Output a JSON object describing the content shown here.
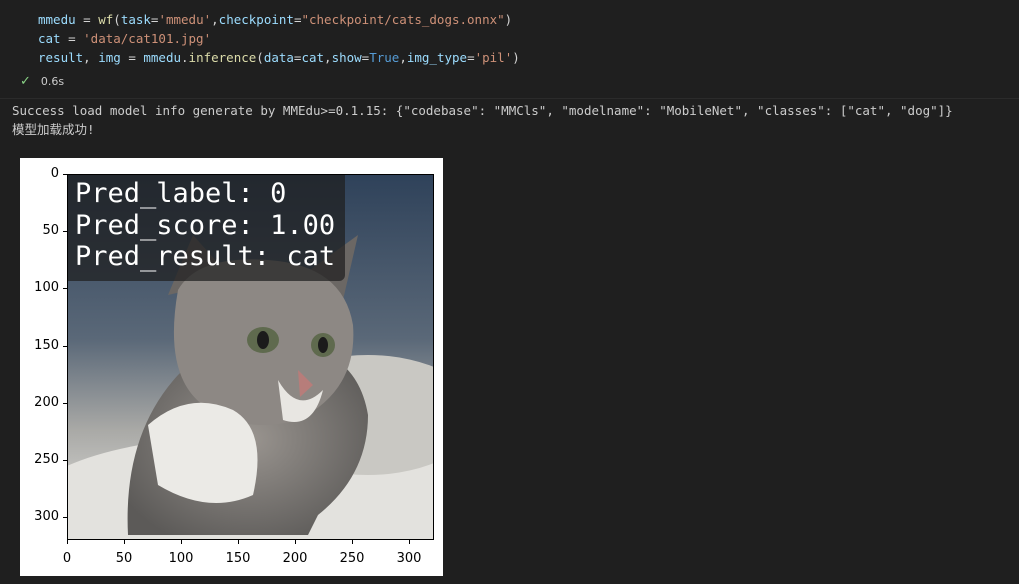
{
  "code": {
    "line1": {
      "var": "mmedu",
      "eq": " = ",
      "fn": "wf",
      "open": "(",
      "p1": "task",
      "e1": "=",
      "v1": "'mmedu'",
      "c1": ",",
      "p2": "checkpoint",
      "e2": "=",
      "v2": "\"checkpoint/cats_dogs.onnx\"",
      "close": ")"
    },
    "line2": {
      "var": "cat",
      "eq": " = ",
      "v": "'data/cat101.jpg'"
    },
    "line3": {
      "var1": "result",
      "comma": ", ",
      "var2": "img",
      "eq": " = ",
      "obj": "mmedu",
      "dot": ".",
      "fn": "inference",
      "open": "(",
      "p1": "data",
      "e1": "=",
      "v1": "cat",
      "c1": ",",
      "p2": "show",
      "e2": "=",
      "v2": "True",
      "c2": ",",
      "p3": "img_type",
      "e3": "=",
      "v3": "'pil'",
      "close": ")"
    }
  },
  "execution": {
    "time": "0.6s"
  },
  "output": {
    "line1": "Success load model info generate by MMEdu>=0.1.15: {\"codebase\": \"MMCls\", \"modelname\": \"MobileNet\", \"classes\": [\"cat\", \"dog\"]}",
    "line2": "模型加载成功!"
  },
  "plot": {
    "overlay": {
      "line1": "Pred_label: 0",
      "line2": "Pred_score: 1.00",
      "line3": "Pred_result: cat"
    },
    "yticks": [
      "0",
      "50",
      "100",
      "150",
      "200",
      "250",
      "300"
    ],
    "xticks": [
      "0",
      "50",
      "100",
      "150",
      "200",
      "250",
      "300"
    ]
  }
}
